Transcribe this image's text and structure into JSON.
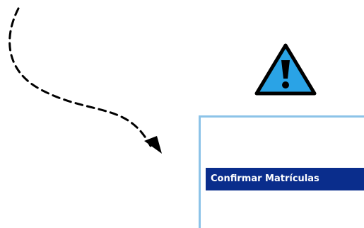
{
  "icons": {
    "curved_arrow": "dashed-curved-arrow-icon",
    "warning": "warning-triangle-icon"
  },
  "colors": {
    "warning_fill": "#2aa3e6",
    "warning_outline": "#000000",
    "panel_border": "#8cc3e8",
    "button_bg": "#0a2d8c",
    "button_text": "#ffffff"
  },
  "panel": {
    "confirm_label": "Confirmar Matrículas"
  }
}
